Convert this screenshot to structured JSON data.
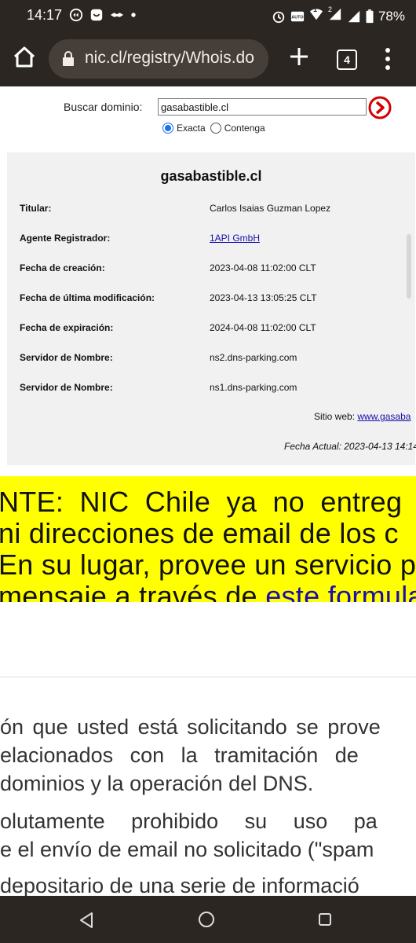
{
  "status_bar": {
    "time": "14:17",
    "battery": "78%",
    "icons": [
      "app-icon-1",
      "app-icon-2",
      "handshake-icon",
      "dot-icon",
      "alarm-icon",
      "auto-hd-icon",
      "wifi-icon",
      "signal-icon",
      "signal-icon",
      "battery-icon"
    ],
    "wifi_badge": "1",
    "signal_badge": "2"
  },
  "browser": {
    "url": "nic.cl/registry/Whois.do",
    "tab_count": "4"
  },
  "search": {
    "label": "Buscar dominio:",
    "value": "gasabastible.cl",
    "option_exact": "Exacta",
    "option_contains": "Contenga",
    "selected": "Exacta"
  },
  "whois": {
    "domain": "gasabastible.cl",
    "rows": [
      {
        "key": "Titular:",
        "value": "Carlos Isaias Guzman Lopez"
      },
      {
        "key": "Agente Registrador:",
        "value": "1API GmbH"
      },
      {
        "key": "Fecha de creación:",
        "value": "2023-04-08 11:02:00 CLT"
      },
      {
        "key": "Fecha de última modificación:",
        "value": "2023-04-13 13:05:25 CLT"
      },
      {
        "key": "Fecha de expiración:",
        "value": "2024-04-08 11:02:00 CLT"
      },
      {
        "key": "Servidor de Nombre:",
        "value": "ns2.dns-parking.com"
      },
      {
        "key": "Servidor de Nombre:",
        "value": "ns1.dns-parking.com"
      }
    ],
    "site_label": "Sitio web:",
    "site_link": "www.gasaba",
    "fecha_actual": "Fecha Actual: 2023-04-13 14:14"
  },
  "notice": {
    "line1": "NTE: NIC Chile ya no entreg",
    "line2": " ni direcciones de email de los c",
    "line3": "En su lugar, provee un servicio p",
    "line4_prefix": "mensaje a través de ",
    "line4_link": "este formula"
  },
  "paragraph": {
    "lines": [
      "ón que usted está solicitando se prove",
      "elacionados con la tramitación de",
      "dominios y la operación del DNS.",
      "olutamente prohibido su uso pa",
      "e el envío de email no solicitado (\"spam",
      "depositario de una serie de informació"
    ]
  },
  "colors": {
    "chrome_bg": "#2b2622",
    "urlbar_bg": "#463e38",
    "notice_bg": "#ffff00",
    "link": "#1a0dab",
    "go_button": "#d50000"
  }
}
